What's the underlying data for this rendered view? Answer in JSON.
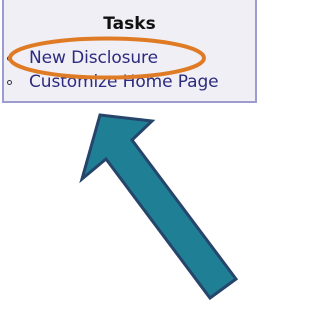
{
  "tasks": {
    "title": "Tasks",
    "items": [
      {
        "label": "New Disclosure"
      },
      {
        "label": "Customize Home Page"
      }
    ]
  },
  "annotations": {
    "highlight_color": "#e07b25",
    "arrow_fill": "#1f7f94",
    "arrow_stroke": "#26456b",
    "highlighted_item": "New Disclosure"
  }
}
